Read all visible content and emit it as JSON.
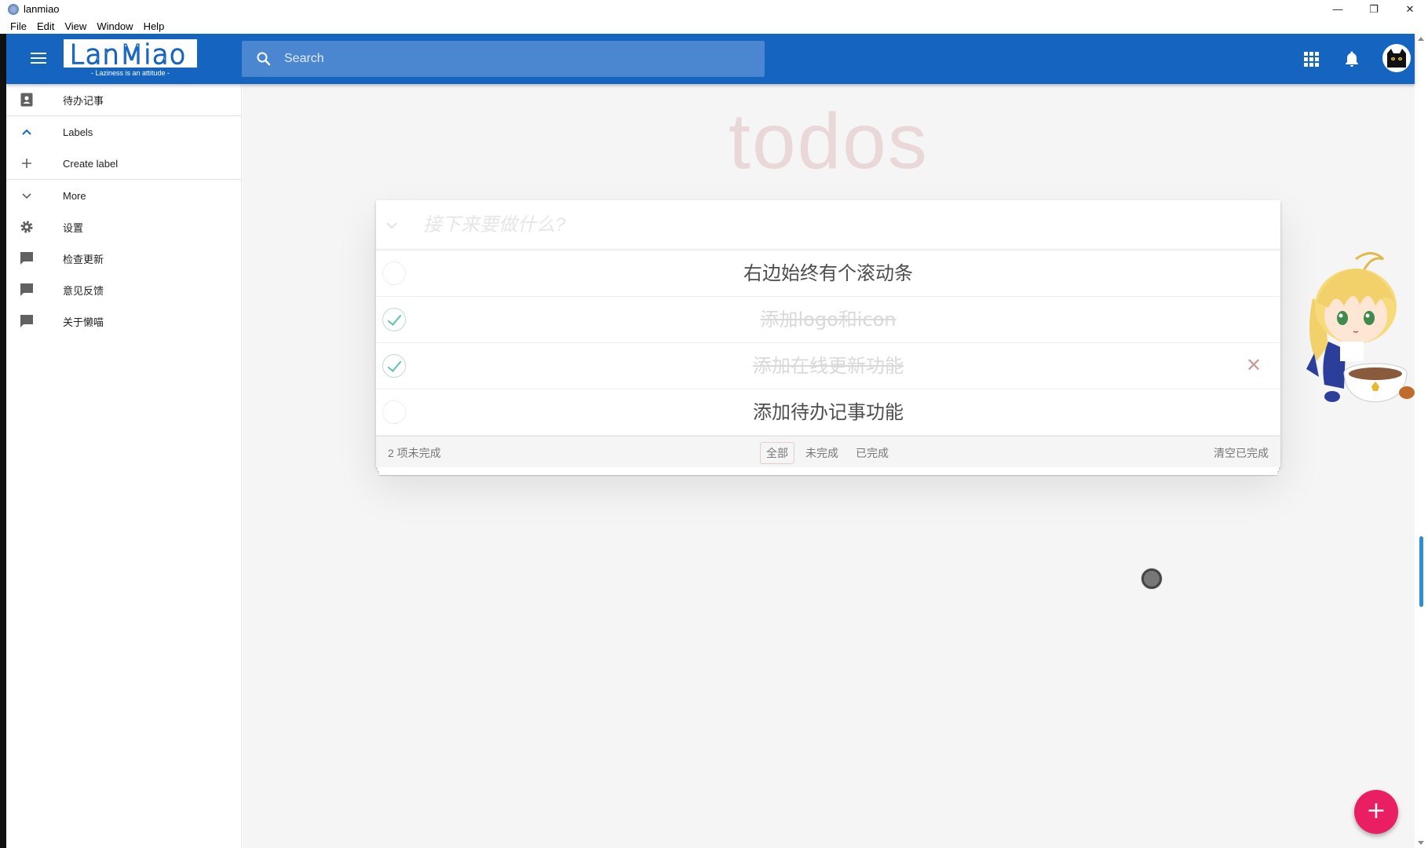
{
  "window": {
    "title": "lanmiao",
    "controls": {
      "minimize": "—",
      "restore": "❐",
      "close": "✕"
    }
  },
  "menubar": {
    "items": [
      "File",
      "Edit",
      "View",
      "Window",
      "Help"
    ]
  },
  "header": {
    "logo_text": "LanMiao",
    "logo_tagline": "- Laziness is an attitude -",
    "search_placeholder": "Search",
    "icons": {
      "menu": "hamburger-icon",
      "apps": "apps-grid-icon",
      "notifications": "bell-icon",
      "account": "cat-avatar"
    },
    "brand_color": "#1565c0"
  },
  "sidebar": {
    "items": [
      {
        "label": "待办记事",
        "icon": "contact-card-icon"
      },
      {
        "label": "Labels",
        "icon": "chevron-up-icon"
      },
      {
        "label": "Create label",
        "icon": "plus-icon"
      },
      {
        "label": "More",
        "icon": "chevron-down-icon"
      },
      {
        "label": "设置",
        "icon": "gear-icon"
      },
      {
        "label": "检查更新",
        "icon": "comment-icon"
      },
      {
        "label": "意见反馈",
        "icon": "comment-icon"
      },
      {
        "label": "关于懒喵",
        "icon": "comment-icon"
      }
    ]
  },
  "todo": {
    "title": "todos",
    "placeholder": "接下来要做什么?",
    "items": [
      {
        "text": "右边始终有个滚动条",
        "completed": false
      },
      {
        "text": "添加logo和icon",
        "completed": true
      },
      {
        "text": "添加在线更新功能",
        "completed": true
      },
      {
        "text": "添加待办记事功能",
        "completed": false
      }
    ],
    "destroy_symbol": "✕",
    "footer": {
      "count": "2 项未完成",
      "filters": [
        "全部",
        "未完成",
        "已完成"
      ],
      "selected_filter": "全部",
      "clear_completed": "清空已完成"
    }
  },
  "fab": {
    "label": "+",
    "color": "#e91e63"
  }
}
